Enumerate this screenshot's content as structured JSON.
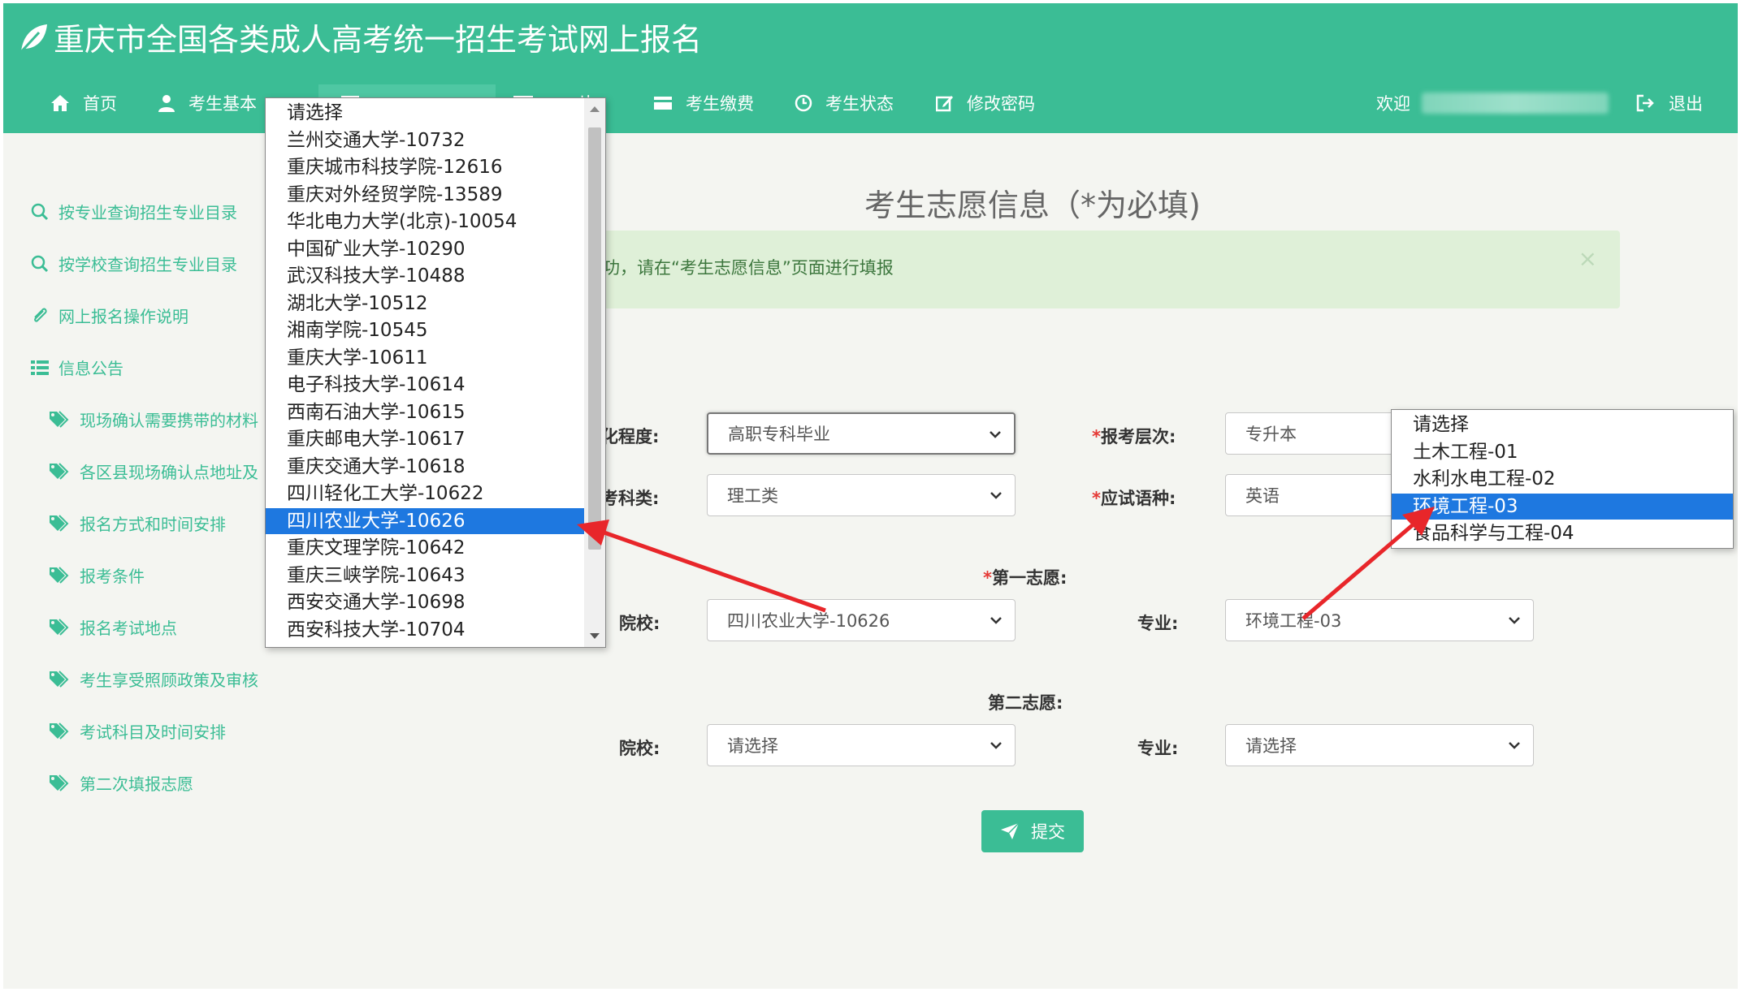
{
  "header": {
    "title": "重庆市全国各类成人高考统一招生考试网上报名",
    "nav": [
      {
        "label": "首页",
        "icon": "home-icon"
      },
      {
        "label": "考生基本",
        "icon": "user-icon"
      },
      {
        "label": "",
        "icon": "form-icon"
      },
      {
        "label": "片",
        "icon": "photo-icon"
      },
      {
        "label": "考生缴费",
        "icon": "card-icon"
      },
      {
        "label": "考生状态",
        "icon": "clock-icon"
      },
      {
        "label": "修改密码",
        "icon": "edit-icon"
      }
    ],
    "welcome": "欢迎",
    "logout": "退出"
  },
  "sidebar": {
    "items": [
      {
        "label": "按专业查询招生专业目录",
        "icon": "search-icon"
      },
      {
        "label": "按学校查询招生专业目录",
        "icon": "search-icon"
      },
      {
        "label": "网上报名操作说明",
        "icon": "paperclip-icon"
      },
      {
        "label": "信息公告",
        "icon": "list-icon"
      },
      {
        "label": "现场确认需要携带的材料",
        "icon": "tag-icon"
      },
      {
        "label": "各区县现场确认点地址及",
        "icon": "tag-icon"
      },
      {
        "label": "报名方式和时间安排",
        "icon": "tag-icon"
      },
      {
        "label": "报考条件",
        "icon": "tag-icon"
      },
      {
        "label": "报名考试地点",
        "icon": "tag-icon"
      },
      {
        "label": "考生享受照顾政策及审核",
        "icon": "tag-icon"
      },
      {
        "label": "考试科目及时间安排",
        "icon": "tag-icon"
      },
      {
        "label": "第二次填报志愿",
        "icon": "tag-icon"
      }
    ]
  },
  "main": {
    "title": "考生志愿信息（*为必填)",
    "alert_text": "功，请在“考生志愿信息”页面进行填报",
    "alert_close": "×",
    "form": {
      "education_label": "化程度:",
      "education_value": "高职专科毕业",
      "level_label": "*报考层次:",
      "level_value": "专升本",
      "category_label": "考科类:",
      "category_value": "理工类",
      "language_label": "*应试语种:",
      "language_value": "英语",
      "first_choice_label": "*第一志愿:",
      "school1_label": "院校:",
      "school1_value": "四川农业大学-10626",
      "major1_label": "专业:",
      "major1_value": "环境工程-03",
      "second_choice_label": "第二志愿:",
      "school2_label": "院校:",
      "school2_value": "请选择",
      "major2_label": "专业:",
      "major2_value": "请选择"
    },
    "submit_label": "提交"
  },
  "school_dropdown": {
    "options": [
      "请选择",
      "兰州交通大学-10732",
      "重庆城市科技学院-12616",
      "重庆对外经贸学院-13589",
      "华北电力大学(北京)-10054",
      "中国矿业大学-10290",
      "武汉科技大学-10488",
      "湖北大学-10512",
      "湘南学院-10545",
      "重庆大学-10611",
      "电子科技大学-10614",
      "西南石油大学-10615",
      "重庆邮电大学-10617",
      "重庆交通大学-10618",
      "四川轻化工大学-10622",
      "四川农业大学-10626",
      "重庆文理学院-10642",
      "重庆三峡学院-10643",
      "西安交通大学-10698",
      "西安科技大学-10704"
    ],
    "selected_index": 15
  },
  "major_dropdown": {
    "options": [
      "请选择",
      "土木工程-01",
      "水利水电工程-02",
      "环境工程-03",
      "食品科学与工程-04"
    ],
    "selected_index": 3
  },
  "colors": {
    "brand": "#3bbd95",
    "selected": "#1e78e0",
    "annotation_arrow": "#e8262a",
    "alert_bg": "#dff0d8"
  }
}
